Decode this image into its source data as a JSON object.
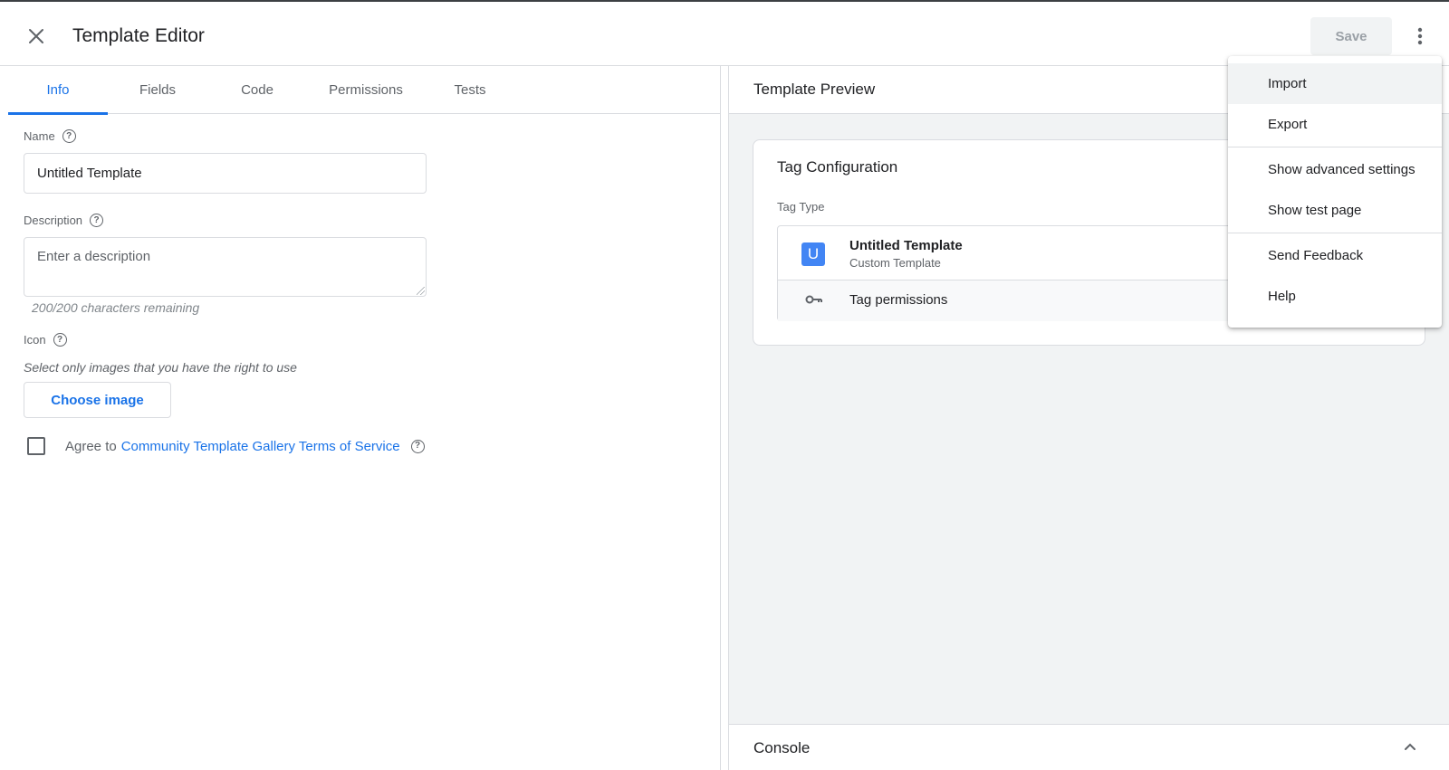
{
  "header": {
    "title": "Template Editor",
    "save_label": "Save"
  },
  "tabs": [
    {
      "label": "Info",
      "active": true
    },
    {
      "label": "Fields"
    },
    {
      "label": "Code"
    },
    {
      "label": "Permissions"
    },
    {
      "label": "Tests"
    }
  ],
  "info": {
    "name_label": "Name",
    "name_value": "Untitled Template",
    "description_label": "Description",
    "description_placeholder": "Enter a description",
    "chars_remaining": "200/200 characters remaining",
    "icon_label": "Icon",
    "icon_hint": "Select only images that you have the right to use",
    "choose_image_label": "Choose image",
    "agree_prefix": "Agree to",
    "tos_link": "Community Template Gallery Terms of Service"
  },
  "preview": {
    "title": "Template Preview",
    "card_title": "Tag Configuration",
    "tag_type_label": "Tag Type",
    "tag_avatar_letter": "U",
    "tag_name": "Untitled Template",
    "tag_subtitle": "Custom Template",
    "tag_permissions": "Tag permissions",
    "console_label": "Console"
  },
  "menu": {
    "items": [
      {
        "label": "Import"
      },
      {
        "label": "Export"
      },
      {
        "label": "Show advanced settings"
      },
      {
        "label": "Show test page"
      },
      {
        "label": "Send Feedback"
      },
      {
        "label": "Help"
      }
    ]
  },
  "colors": {
    "accent": "#1a73e8",
    "avatar": "#4285f4",
    "panel_bg": "#f1f3f4"
  },
  "icons": [
    "close-icon",
    "more-vert-icon",
    "help-icon",
    "key-icon",
    "chevron-up-icon"
  ]
}
